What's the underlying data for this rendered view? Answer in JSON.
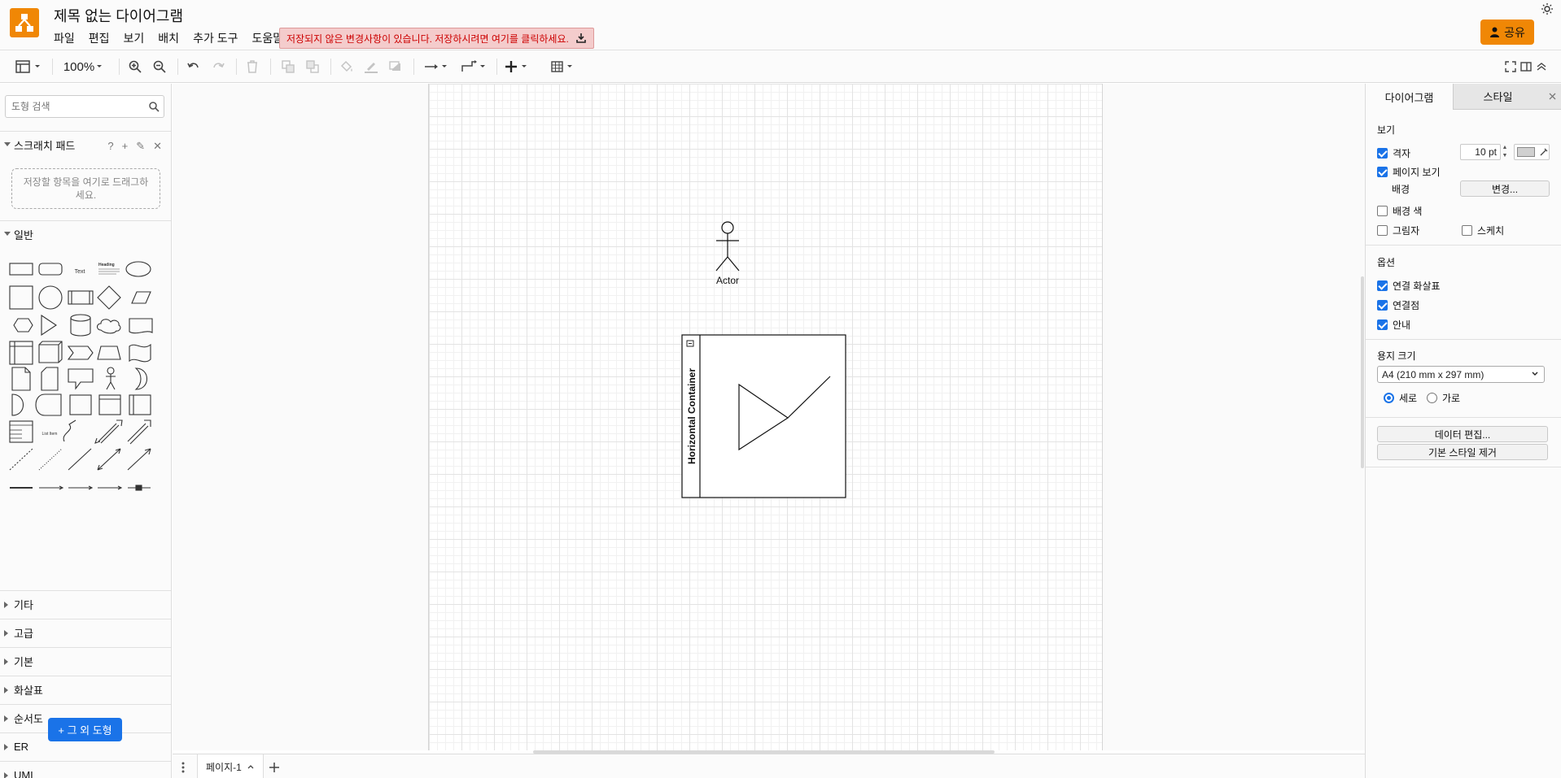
{
  "app": {
    "title": "제목 없는 다이어그램",
    "menu": [
      "파일",
      "편집",
      "보기",
      "배치",
      "추가 도구",
      "도움말"
    ],
    "unsaved_notice": "저장되지 않은 변경사항이 있습니다. 저장하시려면 여기를 클릭하세요.",
    "share_label": "공유",
    "brand_color": "#f08705"
  },
  "toolbar": {
    "zoom": "100%",
    "icons": [
      "format-panel-icon",
      "zoom-in-icon",
      "zoom-out-icon",
      "undo-icon",
      "redo-icon",
      "delete-icon",
      "to-front-icon",
      "to-back-icon",
      "fill-color-icon",
      "line-color-icon",
      "shadow-icon",
      "connection-icon",
      "waypoints-icon",
      "insert-icon",
      "table-icon",
      "fullscreen-icon",
      "toggle-panel-icon",
      "collapse-icon"
    ]
  },
  "left_panel": {
    "search_placeholder": "도형 검색",
    "scratchpad": {
      "title": "스크래치 패드",
      "tools": [
        "?",
        "+",
        "✎",
        "✕"
      ],
      "drop_hint": "저장할 항목을 여기로 드래그하세요."
    },
    "general_title": "일반",
    "shape_text_label": "Text",
    "shape_heading_label": "Heading",
    "shape_list_label": "List Item",
    "collapsed_sections": [
      "기타",
      "고급",
      "기본",
      "화살표",
      "순서도",
      "ER",
      "UML"
    ],
    "more_shapes": "+ 그 외 도형"
  },
  "canvas": {
    "actor_label": "Actor",
    "container_label": "Horizontal Container"
  },
  "page_tabs": {
    "current": "페이지-1"
  },
  "right_panel": {
    "tabs": {
      "diagram": "다이어그램",
      "style": "스타일"
    },
    "view": {
      "title": "보기",
      "grid": {
        "label": "격자",
        "checked": true,
        "size": "10 pt"
      },
      "page_view": {
        "label": "페이지 보기",
        "checked": true
      },
      "background": {
        "label": "배경",
        "button": "변경..."
      },
      "background_color": {
        "label": "배경 색",
        "checked": false
      },
      "shadow": {
        "label": "그림자",
        "checked": false
      },
      "sketch": {
        "label": "스케치",
        "checked": false
      }
    },
    "options": {
      "title": "옵션",
      "connection_arrows": {
        "label": "연결 화살표",
        "checked": true
      },
      "connection_points": {
        "label": "연결점",
        "checked": true
      },
      "guides": {
        "label": "안내",
        "checked": true
      }
    },
    "paper": {
      "title": "용지 크기",
      "selected": "A4 (210 mm x 297 mm)",
      "portrait": "세로",
      "landscape": "가로",
      "orientation": "portrait"
    },
    "edit_data": "데이터 편집...",
    "clear_style": "기본 스타일 제거"
  }
}
